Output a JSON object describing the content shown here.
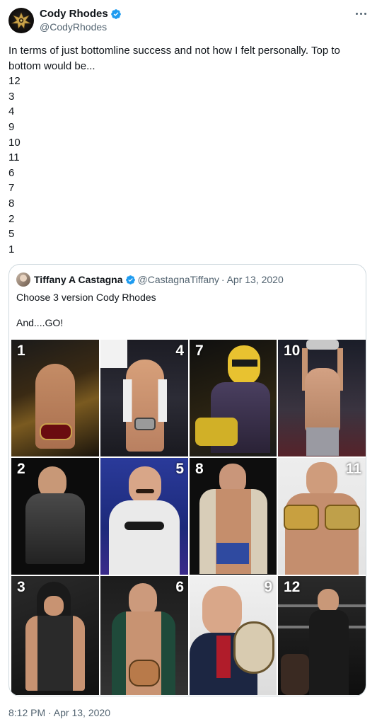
{
  "author": {
    "display_name": "Cody Rhodes",
    "handle": "@CodyRhodes",
    "avatar_icon": "nightmare-logo-icon",
    "verified_icon": "verified-badge-icon"
  },
  "more_icon": "more-options-icon",
  "tweet": {
    "lines": [
      "In terms of just bottomline success and not how I felt personally. Top to",
      "bottom would be...",
      "12",
      "3",
      "4",
      "9",
      "10",
      "11",
      "6",
      "7",
      "8",
      "2",
      "5",
      "1"
    ],
    "timestamp": "8:12 PM · Apr 13, 2020"
  },
  "quote": {
    "display_name": "Tiffany A Castagna",
    "handle": "@CastagnaTiffany",
    "separator": "·",
    "date": "Apr 13, 2020",
    "text_line1": "Choose 3 version Cody Rhodes",
    "text_line2": "And....GO!",
    "grid_labels": [
      "1",
      "4",
      "7",
      "10",
      "2",
      "5",
      "8",
      "11",
      "3",
      "6",
      "9",
      "12"
    ]
  },
  "colors": {
    "text_primary": "#0f1419",
    "text_secondary": "#536471",
    "verified_blue": "#1d9bf0",
    "border": "#cfd9de"
  }
}
